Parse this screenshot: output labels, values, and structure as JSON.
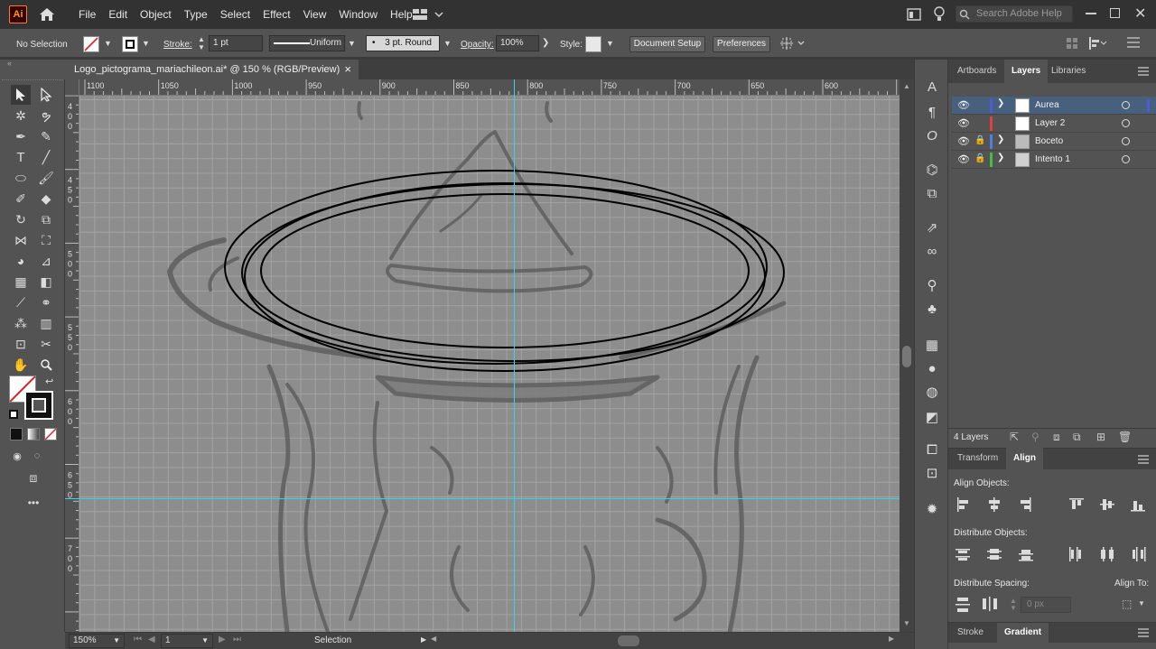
{
  "app": {
    "logo_text": "Ai"
  },
  "menu": [
    "File",
    "Edit",
    "Object",
    "Type",
    "Select",
    "Effect",
    "View",
    "Window",
    "Help"
  ],
  "search": {
    "placeholder": "Search Adobe Help"
  },
  "control": {
    "selection": "No Selection",
    "stroke_label": "Stroke:",
    "stroke_value": "1 pt",
    "profile": "Uniform",
    "brush": "3 pt. Round",
    "opacity_label": "Opacity:",
    "opacity_value": "100%",
    "style_label": "Style:",
    "document_setup": "Document Setup",
    "preferences": "Preferences"
  },
  "document": {
    "tab_title": "Logo_pictograma_mariachileon.ai* @ 150 % (RGB/Preview)",
    "close": "×"
  },
  "ruler": {
    "top": [
      "1100",
      "1050",
      "1000",
      "950",
      "900",
      "850",
      "800",
      "750",
      "700",
      "650",
      "600"
    ],
    "left": [
      {
        "digits": [
          "4",
          "0",
          "0"
        ]
      },
      {
        "digits": [
          "4",
          "5",
          "0"
        ]
      },
      {
        "digits": [
          "5",
          "0",
          "0"
        ]
      },
      {
        "digits": [
          "5",
          "5",
          "0"
        ]
      },
      {
        "digits": [
          "6",
          "0",
          "0"
        ]
      },
      {
        "digits": [
          "6",
          "5",
          "0"
        ]
      },
      {
        "digits": [
          "7",
          "0",
          "0"
        ]
      }
    ]
  },
  "status": {
    "zoom": "150%",
    "artboard": "1",
    "tool": "Selection"
  },
  "panels": {
    "tabs": [
      "Artboards",
      "Layers",
      "Libraries"
    ],
    "active_tab": "Layers",
    "layers": [
      {
        "name": "Aurea",
        "color": "#4f5bd5",
        "locked": false,
        "selected": true
      },
      {
        "name": "Layer 2",
        "color": "#e04040",
        "locked": false,
        "selected": false
      },
      {
        "name": "Boceto",
        "color": "#4f7fe0",
        "locked": true,
        "selected": false
      },
      {
        "name": "Intento 1",
        "color": "#40c040",
        "locked": true,
        "selected": false
      }
    ],
    "layer_count": "4 Layers",
    "lower_tabs": [
      "Transform",
      "Align"
    ],
    "align_objects": "Align Objects:",
    "distribute_objects": "Distribute Objects:",
    "distribute_spacing": "Distribute Spacing:",
    "align_to": "Align To:",
    "spacing_value": "0 px",
    "bottom_tabs": [
      "Stroke",
      "Gradient"
    ]
  }
}
